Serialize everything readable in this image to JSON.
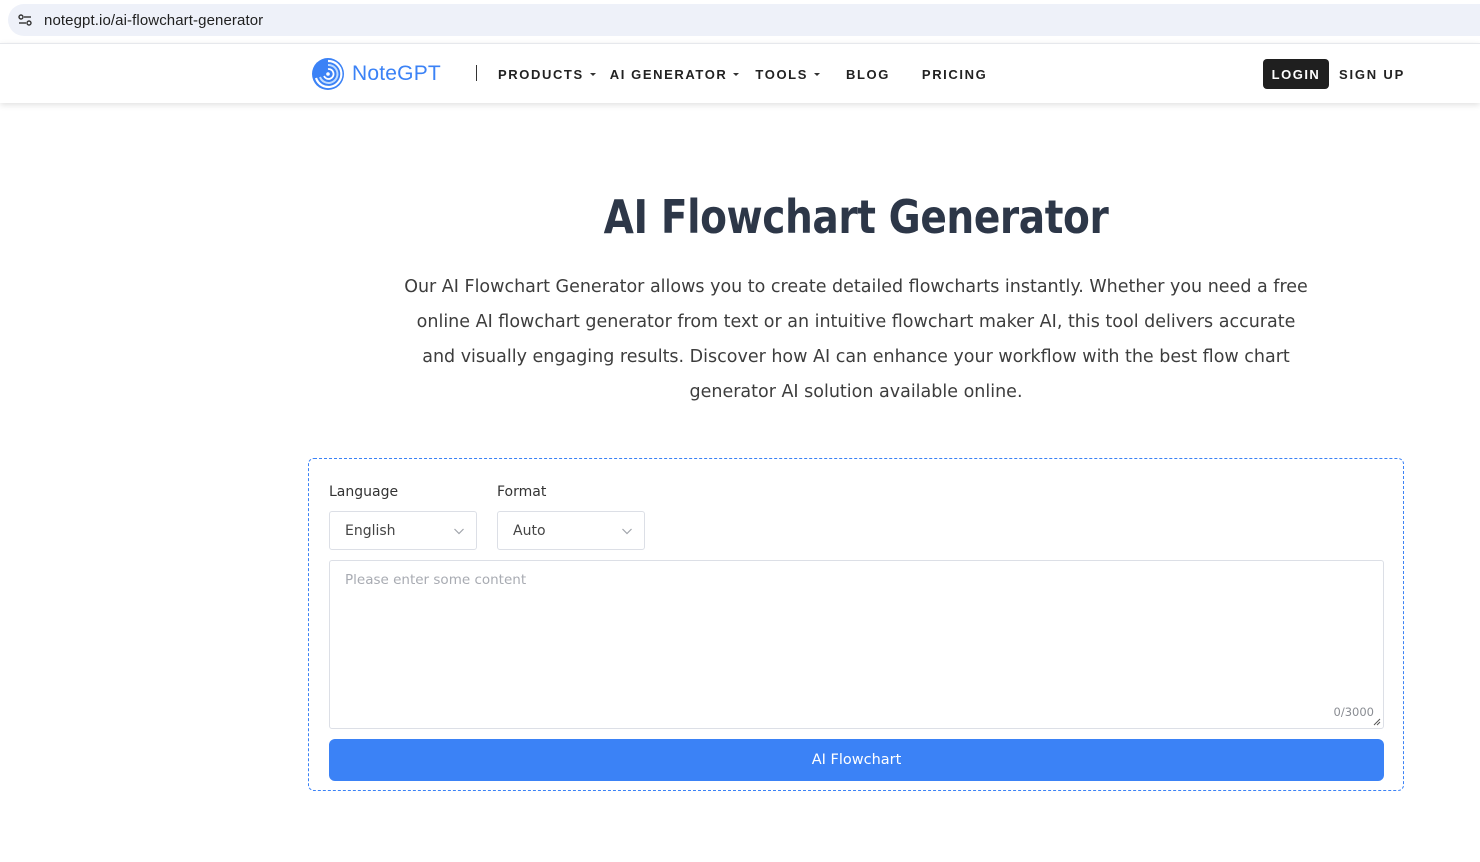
{
  "browser": {
    "url": "notegpt.io/ai-flowchart-generator"
  },
  "header": {
    "logo_text": "NoteGPT",
    "nav": [
      {
        "label": "PRODUCTS",
        "has_dropdown": true
      },
      {
        "label": "AI GENERATOR",
        "has_dropdown": true
      },
      {
        "label": "TOOLS",
        "has_dropdown": true
      },
      {
        "label": "BLOG",
        "has_dropdown": false
      },
      {
        "label": "PRICING",
        "has_dropdown": false
      }
    ],
    "login_label": "LOGIN",
    "signup_label": "SIGN UP"
  },
  "hero": {
    "title": "AI Flowchart Generator",
    "description": "Our AI Flowchart Generator allows you to create detailed flowcharts instantly. Whether you need a free online AI flowchart generator from text or an intuitive flowchart maker AI, this tool delivers accurate and visually engaging results. Discover how AI can enhance your workflow with the best flow chart generator AI solution available online."
  },
  "tool": {
    "language_label": "Language",
    "language_value": "English",
    "format_label": "Format",
    "format_value": "Auto",
    "input_placeholder": "Please enter some content",
    "counter": "0/3000",
    "submit_label": "AI Flowchart"
  },
  "colors": {
    "accent": "#3b82f6",
    "dark_button": "#1f1f1f",
    "title_text": "#2d3748"
  }
}
